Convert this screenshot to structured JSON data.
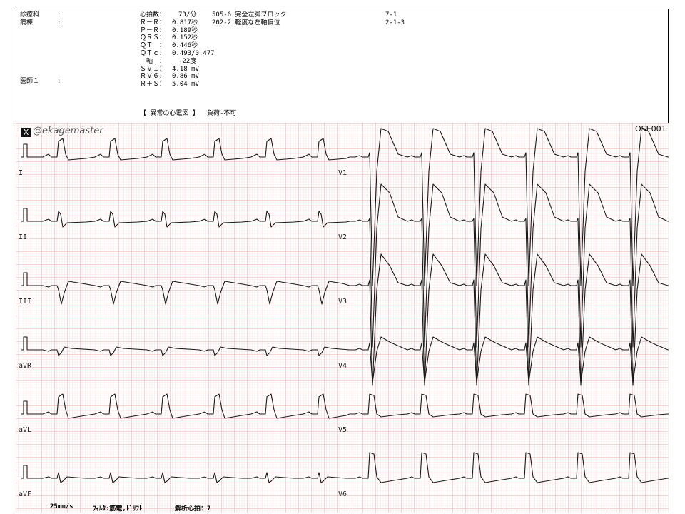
{
  "header": {
    "dept_label": "診療科",
    "dept_colon": ":",
    "ward_label": "病棟",
    "ward_colon": ":",
    "doctor_label": "医師１",
    "doctor_colon": ":",
    "measurements": [
      {
        "label": "心拍数：",
        "value": "　73/分"
      },
      {
        "label": "Ｒ－Ｒ：",
        "value": "0.817秒"
      },
      {
        "label": "Ｐ－Ｒ：",
        "value": "0.189秒"
      },
      {
        "label": "ＱＲＳ：",
        "value": "0.152秒"
      },
      {
        "label": "ＱＴ　：",
        "value": "0.446秒"
      },
      {
        "label": "ＱＴｃ：",
        "value": "0.493/0.477"
      },
      {
        "label": "　軸　：",
        "value": "　-22度"
      },
      {
        "label": "ＳＶ１：",
        "value": "4.18 mV"
      },
      {
        "label": "ＲＶ６：",
        "value": "0.86 mV"
      },
      {
        "label": "Ｒ＋Ｓ：",
        "value": "5.04 mV"
      }
    ],
    "findings": [
      {
        "code": "505-6",
        "text": "完全左脚ブロック"
      },
      {
        "code": "202-2",
        "text": "軽度な左軸偏位"
      }
    ],
    "codes": [
      "7-1",
      "2-1-3"
    ],
    "classification": "【 異常の心電図 】",
    "load": "負荷-不可"
  },
  "watermark": "@ekagemaster",
  "watermark_logo": "X",
  "sheet_code": "OSE001",
  "leads_left": [
    "I",
    "II",
    "III",
    "aVR",
    "aVL",
    "aVF"
  ],
  "leads_right": [
    "V1",
    "V2",
    "V3",
    "V4",
    "V5",
    "V6"
  ],
  "footer": {
    "speed": "25mm/s",
    "filter": "ﾌｨﾙﾀ:筋電,ﾄﾞﾘﾌﾄ",
    "beats": "解析心拍：7"
  },
  "colors": {
    "grid_minor": "#f6c8c8",
    "grid_major": "#ec9a9a",
    "trace": "#1a1a1a"
  }
}
